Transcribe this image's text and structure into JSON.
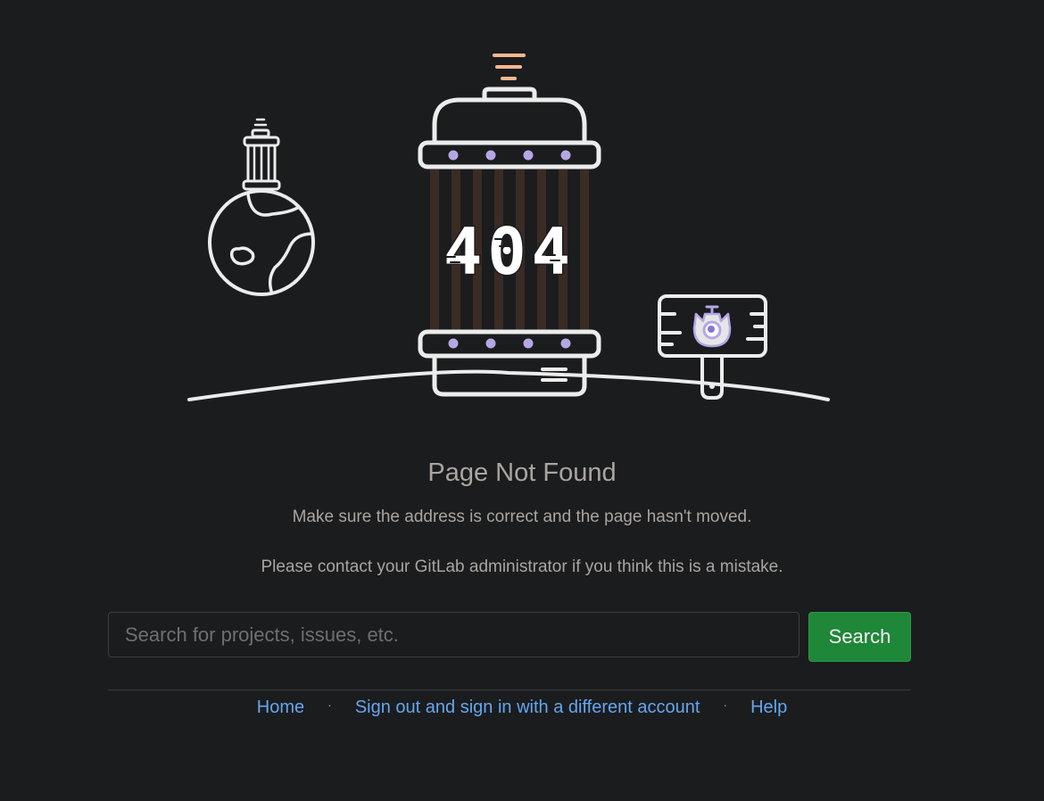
{
  "error": {
    "code": "404",
    "title": "Page Not Found",
    "message_1": "Make sure the address is correct and the page hasn't moved.",
    "message_2": "Please contact your GitLab administrator if you think this is a mistake."
  },
  "search": {
    "placeholder": "Search for projects, issues, etc.",
    "value": "",
    "button_label": "Search"
  },
  "footer": {
    "links": [
      {
        "label": "Home"
      },
      {
        "label": "Sign out and sign in with a different account"
      },
      {
        "label": "Help"
      }
    ],
    "separator": "·"
  },
  "colors": {
    "background": "#1b1c1e",
    "line": "#ececec",
    "accent_purple": "#b5a7e6",
    "accent_orange": "#fcb68e",
    "tube_brown": "#3a2b24",
    "button_green": "#1f8738",
    "link_blue": "#63a6f0"
  },
  "illustration": {
    "icons": [
      "planet-icon",
      "capsule-icon",
      "signpost-icon",
      "tanuki-icon"
    ]
  }
}
